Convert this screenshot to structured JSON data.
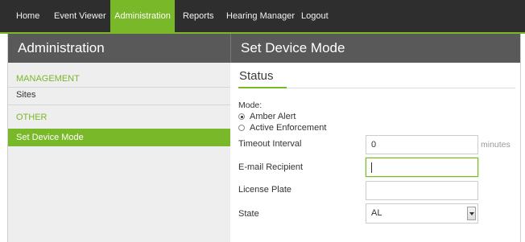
{
  "navbar": {
    "items": [
      {
        "label": "Home"
      },
      {
        "label": "Event Viewer"
      },
      {
        "label": "Administration",
        "active": true
      },
      {
        "label": "Reports"
      },
      {
        "label": "Hearing Manager"
      },
      {
        "label": "Logout"
      }
    ],
    "accent_color": "#79b829",
    "background_color": "#2e2e2e"
  },
  "sidebar": {
    "title": "Administration",
    "sections": [
      {
        "heading": "MANAGEMENT",
        "items": [
          {
            "label": "Sites"
          }
        ]
      },
      {
        "heading": "OTHER",
        "items": [
          {
            "label": "Set Device Mode",
            "active": true
          }
        ]
      }
    ]
  },
  "main": {
    "title": "Set Device Mode",
    "section_title": "Status",
    "mode": {
      "label": "Mode:",
      "options": [
        {
          "label": "Amber Alert",
          "checked": true
        },
        {
          "label": "Active Enforcement",
          "checked": false
        }
      ]
    },
    "fields": {
      "timeout": {
        "label": "Timeout Interval",
        "value": "0",
        "unit": "minutes"
      },
      "email": {
        "label": "E-mail Recipient",
        "value": ""
      },
      "plate": {
        "label": "License Plate",
        "value": ""
      },
      "state": {
        "label": "State",
        "value": "AL"
      }
    }
  }
}
